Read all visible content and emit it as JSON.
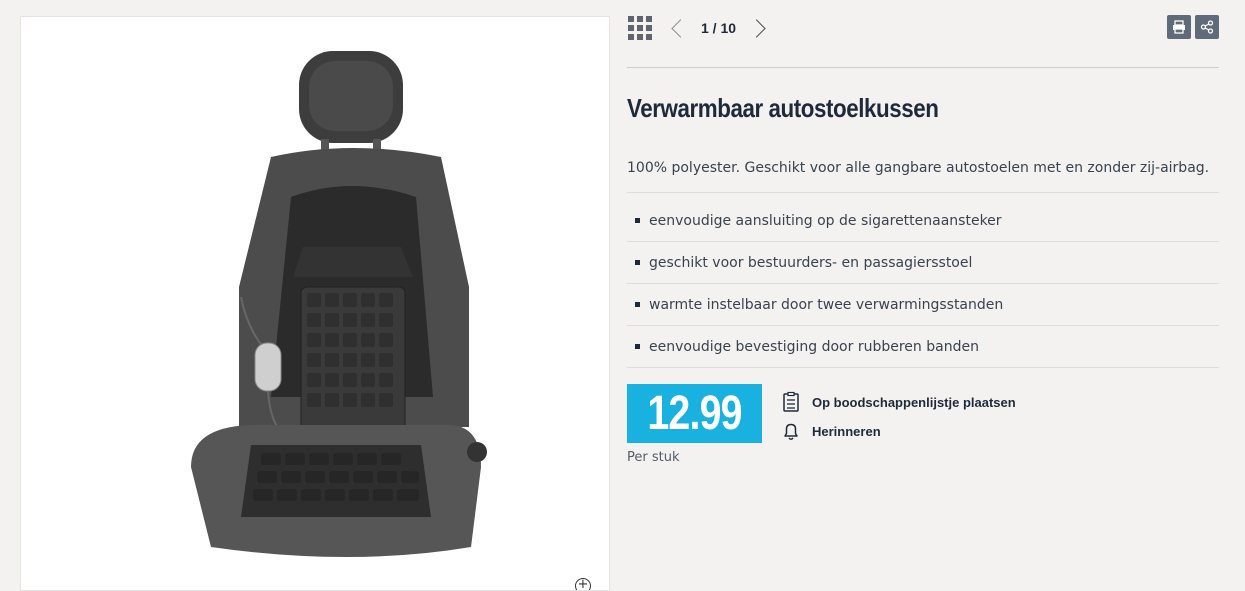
{
  "gallery": {
    "counter": "1 / 10"
  },
  "product": {
    "title": "Verwarmbaar autostoelkussen",
    "description": "100% polyester. Geschikt voor alle gangbare autostoelen met en zonder zij-airbag.",
    "features": [
      "eenvoudige aansluiting op de sigarettenaansteker",
      "geschikt voor bestuurders- en passagiersstoel",
      "warmte instelbaar door twee verwarmingsstanden",
      "eenvoudige bevestiging door rubberen banden"
    ],
    "price": "12.99",
    "unit": "Per stuk"
  },
  "actions": {
    "shopping_list": "Op boodschappenlijstje plaatsen",
    "remind": "Herinneren"
  },
  "icons": {
    "grid": "grid-view-icon",
    "prev": "chevron-left-icon",
    "next": "chevron-right-icon",
    "print": "print-icon",
    "share": "share-icon",
    "zoom": "zoom-in-icon",
    "list": "clipboard-list-icon",
    "bell": "bell-icon"
  },
  "colors": {
    "price_bg": "#19b1e0",
    "title": "#1e2a3a",
    "tool_btn": "#5f6b7a",
    "background": "#f3f2f1"
  }
}
